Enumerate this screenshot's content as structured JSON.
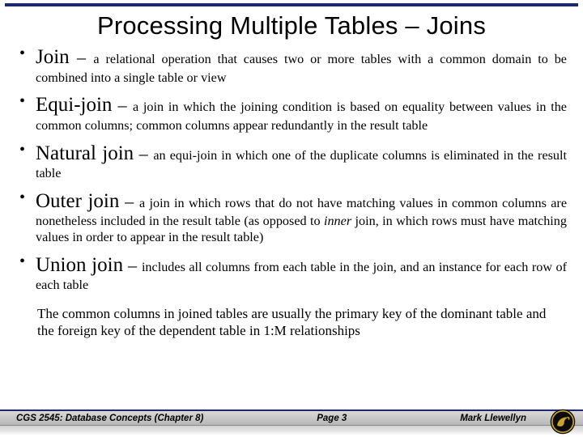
{
  "title": "Processing Multiple Tables – Joins",
  "bullets": [
    {
      "term": "Join",
      "dash": " – ",
      "def": "a relational operation that causes two or more tables with a common domain to be combined into a single table or view"
    },
    {
      "term": "Equi-join",
      "dash": " – ",
      "def": "a join in which the joining condition is based on equality between values in the common columns; common columns appear redundantly in the result table"
    },
    {
      "term": "Natural join",
      "dash": " – ",
      "def": "an equi-join in which one of the duplicate columns is eliminated in the result table"
    },
    {
      "term": "Outer join",
      "dash": " – ",
      "def_pre": "a join in which rows that do not have matching values in common columns are nonetheless included in the result table (as opposed to ",
      "def_em": "inner",
      "def_post": " join, in which rows must have matching values in order to appear in the result table)"
    },
    {
      "term": "Union join",
      "dash": " – ",
      "def": "includes all columns from each table in the join, and an instance for each row of each table"
    }
  ],
  "note": "The common columns in joined tables are usually the primary key  of the dominant table and the foreign key of the dependent table in 1:M relationships",
  "footer": {
    "course": "CGS 2545: Database Concepts  (Chapter 8)",
    "page": "Page 3",
    "author": "Mark Llewellyn"
  }
}
